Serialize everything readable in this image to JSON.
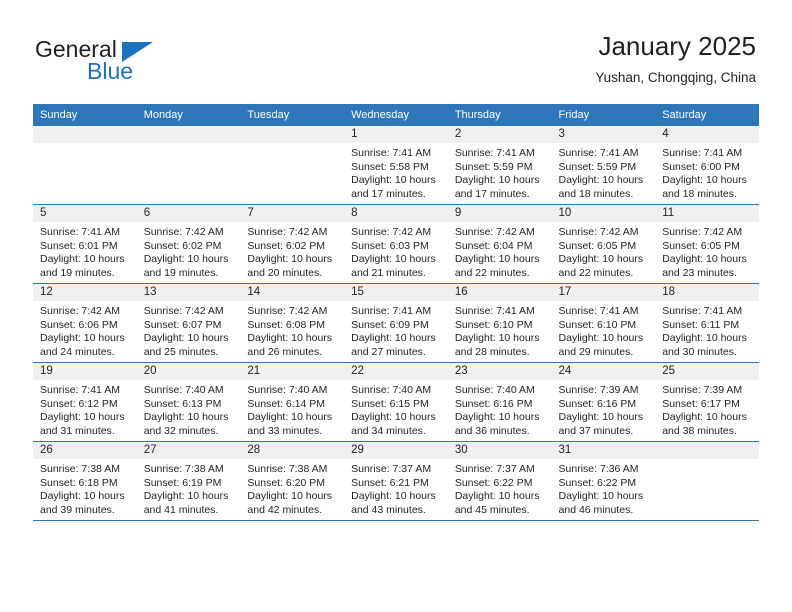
{
  "brand": {
    "name_top": "General",
    "name_bottom": "Blue",
    "triangle_color": "#1e72bd"
  },
  "header": {
    "title": "January 2025",
    "subtitle": "Yushan, Chongqing, China"
  },
  "theme": {
    "header_blue": "#2e76b8",
    "daynum_strip": "#f0f0f0",
    "text": "#231f20"
  },
  "weekdays": [
    "Sunday",
    "Monday",
    "Tuesday",
    "Wednesday",
    "Thursday",
    "Friday",
    "Saturday"
  ],
  "labels": {
    "sunrise": "Sunrise:",
    "sunset": "Sunset:",
    "daylight": "Daylight:"
  },
  "weeks": [
    [
      {
        "day": "",
        "lines": []
      },
      {
        "day": "",
        "lines": []
      },
      {
        "day": "",
        "lines": []
      },
      {
        "day": "1",
        "lines": [
          "Sunrise: 7:41 AM",
          "Sunset: 5:58 PM",
          "Daylight: 10 hours",
          "and 17 minutes."
        ]
      },
      {
        "day": "2",
        "lines": [
          "Sunrise: 7:41 AM",
          "Sunset: 5:59 PM",
          "Daylight: 10 hours",
          "and 17 minutes."
        ]
      },
      {
        "day": "3",
        "lines": [
          "Sunrise: 7:41 AM",
          "Sunset: 5:59 PM",
          "Daylight: 10 hours",
          "and 18 minutes."
        ]
      },
      {
        "day": "4",
        "lines": [
          "Sunrise: 7:41 AM",
          "Sunset: 6:00 PM",
          "Daylight: 10 hours",
          "and 18 minutes."
        ]
      }
    ],
    [
      {
        "day": "5",
        "lines": [
          "Sunrise: 7:41 AM",
          "Sunset: 6:01 PM",
          "Daylight: 10 hours",
          "and 19 minutes."
        ]
      },
      {
        "day": "6",
        "lines": [
          "Sunrise: 7:42 AM",
          "Sunset: 6:02 PM",
          "Daylight: 10 hours",
          "and 19 minutes."
        ]
      },
      {
        "day": "7",
        "lines": [
          "Sunrise: 7:42 AM",
          "Sunset: 6:02 PM",
          "Daylight: 10 hours",
          "and 20 minutes."
        ]
      },
      {
        "day": "8",
        "lines": [
          "Sunrise: 7:42 AM",
          "Sunset: 6:03 PM",
          "Daylight: 10 hours",
          "and 21 minutes."
        ]
      },
      {
        "day": "9",
        "lines": [
          "Sunrise: 7:42 AM",
          "Sunset: 6:04 PM",
          "Daylight: 10 hours",
          "and 22 minutes."
        ]
      },
      {
        "day": "10",
        "lines": [
          "Sunrise: 7:42 AM",
          "Sunset: 6:05 PM",
          "Daylight: 10 hours",
          "and 22 minutes."
        ]
      },
      {
        "day": "11",
        "lines": [
          "Sunrise: 7:42 AM",
          "Sunset: 6:05 PM",
          "Daylight: 10 hours",
          "and 23 minutes."
        ]
      }
    ],
    [
      {
        "day": "12",
        "lines": [
          "Sunrise: 7:42 AM",
          "Sunset: 6:06 PM",
          "Daylight: 10 hours",
          "and 24 minutes."
        ]
      },
      {
        "day": "13",
        "lines": [
          "Sunrise: 7:42 AM",
          "Sunset: 6:07 PM",
          "Daylight: 10 hours",
          "and 25 minutes."
        ]
      },
      {
        "day": "14",
        "lines": [
          "Sunrise: 7:42 AM",
          "Sunset: 6:08 PM",
          "Daylight: 10 hours",
          "and 26 minutes."
        ]
      },
      {
        "day": "15",
        "lines": [
          "Sunrise: 7:41 AM",
          "Sunset: 6:09 PM",
          "Daylight: 10 hours",
          "and 27 minutes."
        ]
      },
      {
        "day": "16",
        "lines": [
          "Sunrise: 7:41 AM",
          "Sunset: 6:10 PM",
          "Daylight: 10 hours",
          "and 28 minutes."
        ]
      },
      {
        "day": "17",
        "lines": [
          "Sunrise: 7:41 AM",
          "Sunset: 6:10 PM",
          "Daylight: 10 hours",
          "and 29 minutes."
        ]
      },
      {
        "day": "18",
        "lines": [
          "Sunrise: 7:41 AM",
          "Sunset: 6:11 PM",
          "Daylight: 10 hours",
          "and 30 minutes."
        ]
      }
    ],
    [
      {
        "day": "19",
        "lines": [
          "Sunrise: 7:41 AM",
          "Sunset: 6:12 PM",
          "Daylight: 10 hours",
          "and 31 minutes."
        ]
      },
      {
        "day": "20",
        "lines": [
          "Sunrise: 7:40 AM",
          "Sunset: 6:13 PM",
          "Daylight: 10 hours",
          "and 32 minutes."
        ]
      },
      {
        "day": "21",
        "lines": [
          "Sunrise: 7:40 AM",
          "Sunset: 6:14 PM",
          "Daylight: 10 hours",
          "and 33 minutes."
        ]
      },
      {
        "day": "22",
        "lines": [
          "Sunrise: 7:40 AM",
          "Sunset: 6:15 PM",
          "Daylight: 10 hours",
          "and 34 minutes."
        ]
      },
      {
        "day": "23",
        "lines": [
          "Sunrise: 7:40 AM",
          "Sunset: 6:16 PM",
          "Daylight: 10 hours",
          "and 36 minutes."
        ]
      },
      {
        "day": "24",
        "lines": [
          "Sunrise: 7:39 AM",
          "Sunset: 6:16 PM",
          "Daylight: 10 hours",
          "and 37 minutes."
        ]
      },
      {
        "day": "25",
        "lines": [
          "Sunrise: 7:39 AM",
          "Sunset: 6:17 PM",
          "Daylight: 10 hours",
          "and 38 minutes."
        ]
      }
    ],
    [
      {
        "day": "26",
        "lines": [
          "Sunrise: 7:38 AM",
          "Sunset: 6:18 PM",
          "Daylight: 10 hours",
          "and 39 minutes."
        ]
      },
      {
        "day": "27",
        "lines": [
          "Sunrise: 7:38 AM",
          "Sunset: 6:19 PM",
          "Daylight: 10 hours",
          "and 41 minutes."
        ]
      },
      {
        "day": "28",
        "lines": [
          "Sunrise: 7:38 AM",
          "Sunset: 6:20 PM",
          "Daylight: 10 hours",
          "and 42 minutes."
        ]
      },
      {
        "day": "29",
        "lines": [
          "Sunrise: 7:37 AM",
          "Sunset: 6:21 PM",
          "Daylight: 10 hours",
          "and 43 minutes."
        ]
      },
      {
        "day": "30",
        "lines": [
          "Sunrise: 7:37 AM",
          "Sunset: 6:22 PM",
          "Daylight: 10 hours",
          "and 45 minutes."
        ]
      },
      {
        "day": "31",
        "lines": [
          "Sunrise: 7:36 AM",
          "Sunset: 6:22 PM",
          "Daylight: 10 hours",
          "and 46 minutes."
        ]
      },
      {
        "day": "",
        "lines": []
      }
    ]
  ]
}
